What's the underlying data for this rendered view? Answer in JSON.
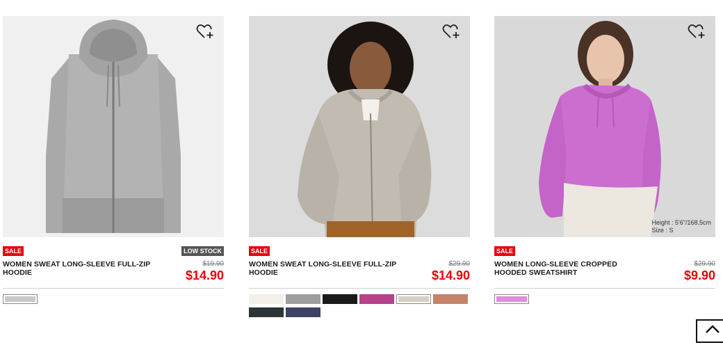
{
  "products": [
    {
      "name": "WOMEN SWEAT LONG-SLEEVE FULL-ZIP HOODIE",
      "sale_badge": "SALE",
      "stock_badge": "LOW STOCK",
      "original_price": "$19.90",
      "price": "$14.90",
      "caption_lines": [],
      "swatches": [
        "#c8c8c8"
      ],
      "selected_swatch": 0
    },
    {
      "name": "WOMEN SWEAT LONG-SLEEVE FULL-ZIP HOODIE",
      "sale_badge": "SALE",
      "stock_badge": "",
      "original_price": "$29.90",
      "price": "$14.90",
      "caption_lines": [],
      "swatches": [
        "#f3efe9",
        "#9e9e9e",
        "#1a1a1a",
        "#b5428a",
        "#d6cfc2",
        "#c4846a",
        "#2d3436",
        "#3e4266"
      ],
      "selected_swatch": 4
    },
    {
      "name": "WOMEN LONG-SLEEVE CROPPED HOODED SWEATSHIRT",
      "sale_badge": "SALE",
      "stock_badge": "",
      "original_price": "$29.90",
      "price": "$9.90",
      "caption_lines": [
        "Height : 5'6\"/168.5cm",
        "Size : S"
      ],
      "swatches": [
        "#e08ddb"
      ],
      "selected_swatch": 0
    }
  ]
}
